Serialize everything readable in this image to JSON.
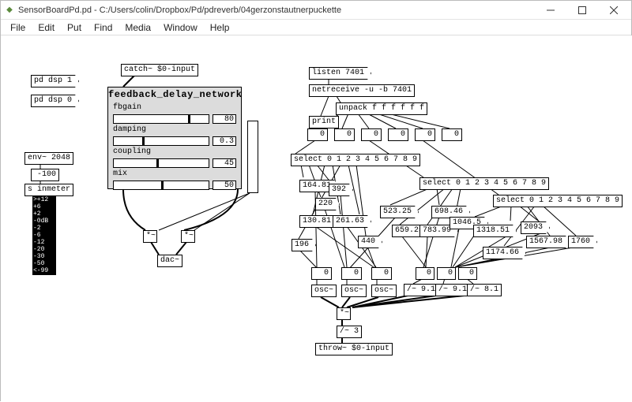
{
  "window": {
    "title": "SensorBoardPd.pd  - C:/Users/colin/Dropbox/Pd/pdreverb/04gerzonstautnerpuckette"
  },
  "menu": {
    "file": "File",
    "edit": "Edit",
    "put": "Put",
    "find": "Find",
    "media": "Media",
    "window": "Window",
    "help": "Help"
  },
  "left": {
    "dsp1": "pd dsp 1",
    "dsp0": "pd dsp 0",
    "env": "env~ 2048",
    "env_num": "-100",
    "inmeter": "s inmeter",
    "vumeter_labels": [
      ">+12",
      "+6",
      "+2",
      "-0dB",
      "-2",
      "-6",
      "-12",
      "-20",
      "-30",
      "-50",
      "<-99"
    ]
  },
  "top": {
    "catch": "catch~ $0-input"
  },
  "fdn": {
    "title": "feedback_delay_network",
    "fbgain_label": "fbgain",
    "fbgain_val": "80",
    "damping_label": "damping",
    "damping_val": "0.3",
    "coupling_label": "coupling",
    "coupling_val": "45",
    "mix_label": "mix",
    "mix_val": "50",
    "mul_left": "*~",
    "mul_right": "*~",
    "dac": "dac~"
  },
  "net": {
    "listen": "listen 7401",
    "netreceive": "netreceive -u -b 7401",
    "print": "print",
    "unpack": "unpack f f f f f f",
    "n0": "0",
    "n1": "0",
    "n2": "0",
    "n3": "0",
    "n4": "0",
    "n5": "0",
    "select1": "select 0 1 2 3 4 5 6 7 8 9",
    "select2": "select 0 1 2 3 4 5 6 7 8 9",
    "select3": "select 0 1 2 3 4 5 6 7 8 9",
    "v_164": "164.81",
    "v_220": "220",
    "v_392": "392",
    "v_130": "130.81",
    "v_261": "261.63",
    "v_196": "196",
    "v_523": "523.25",
    "v_440": "440",
    "v_698": "698.46",
    "v_659": "659.25",
    "v_783": "783.99",
    "v_1046": "1046.5",
    "v_1318": "1318.51",
    "v_2093": "2093",
    "v_1174": "1174.66",
    "v_1567": "1567.98",
    "v_1760": "1760",
    "r0": "0",
    "r1": "0",
    "r2": "0",
    "osc1": "osc~",
    "osc2": "osc~",
    "osc3": "osc~",
    "div1": "/~ 9.1",
    "div2": "/~ 9.1",
    "div3": "/~ 8.1",
    "mul_sum": "*~",
    "div_final": "/~ 3",
    "throw": "throw~ $0-input"
  }
}
